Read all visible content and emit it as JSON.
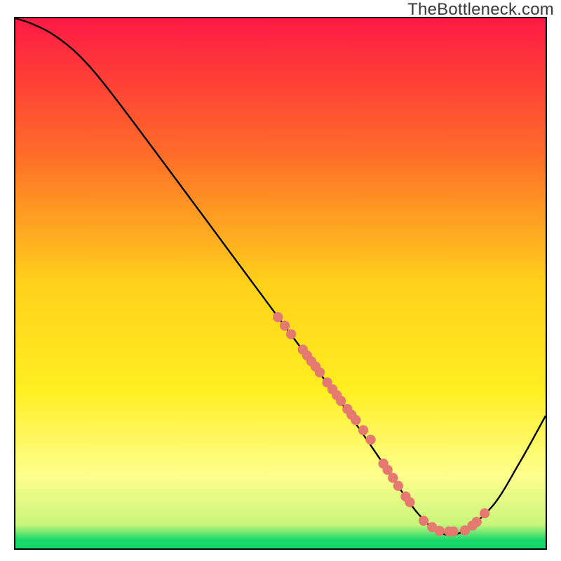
{
  "watermark": "TheBottleneck.com",
  "colors": {
    "red": "#ff1a44",
    "orange": "#ff8a1e",
    "yellow": "#ffe600",
    "paleYellow": "#ffff8c",
    "green": "#17d76a",
    "curve": "#000000",
    "dot": "#e47a6f",
    "frame": "#000000"
  },
  "chart_data": {
    "type": "line",
    "title": "",
    "xlabel": "",
    "ylabel": "",
    "xlim": [
      0,
      100
    ],
    "ylim": [
      0,
      100
    ],
    "curve": {
      "x": [
        0,
        3,
        7,
        12,
        18,
        30,
        40,
        50,
        60,
        68,
        72,
        76,
        80,
        84,
        90,
        95,
        100
      ],
      "y": [
        100,
        99,
        97,
        93,
        86,
        70,
        56.5,
        43,
        29.5,
        18,
        12,
        6.5,
        3,
        3,
        8,
        16,
        25
      ]
    },
    "dots": [
      {
        "x": 49.5,
        "y": 43.6
      },
      {
        "x": 50.8,
        "y": 42.0
      },
      {
        "x": 52.0,
        "y": 40.4
      },
      {
        "x": 54.2,
        "y": 37.5
      },
      {
        "x": 55.0,
        "y": 36.4
      },
      {
        "x": 55.8,
        "y": 35.3
      },
      {
        "x": 56.6,
        "y": 34.3
      },
      {
        "x": 57.4,
        "y": 33.2
      },
      {
        "x": 58.8,
        "y": 31.3
      },
      {
        "x": 59.8,
        "y": 30.0
      },
      {
        "x": 60.6,
        "y": 28.9
      },
      {
        "x": 61.4,
        "y": 27.8
      },
      {
        "x": 62.6,
        "y": 26.3
      },
      {
        "x": 63.4,
        "y": 25.2
      },
      {
        "x": 64.2,
        "y": 24.2
      },
      {
        "x": 65.6,
        "y": 22.3
      },
      {
        "x": 67.0,
        "y": 20.5
      },
      {
        "x": 69.4,
        "y": 16.0
      },
      {
        "x": 70.2,
        "y": 14.8
      },
      {
        "x": 71.2,
        "y": 13.3
      },
      {
        "x": 72.2,
        "y": 11.8
      },
      {
        "x": 73.6,
        "y": 9.8
      },
      {
        "x": 74.4,
        "y": 8.7
      },
      {
        "x": 77.0,
        "y": 5.2
      },
      {
        "x": 78.6,
        "y": 4.0
      },
      {
        "x": 80.0,
        "y": 3.3
      },
      {
        "x": 81.8,
        "y": 3.2
      },
      {
        "x": 82.6,
        "y": 3.2
      },
      {
        "x": 84.8,
        "y": 3.4
      },
      {
        "x": 86.2,
        "y": 4.3
      },
      {
        "x": 87.0,
        "y": 5.0
      },
      {
        "x": 88.5,
        "y": 6.6
      }
    ],
    "gradient_stops": [
      {
        "offset": 0.0,
        "color": "#ff1a44"
      },
      {
        "offset": 0.25,
        "color": "#ff6a2a"
      },
      {
        "offset": 0.5,
        "color": "#ffd11a"
      },
      {
        "offset": 0.7,
        "color": "#ffee20"
      },
      {
        "offset": 0.86,
        "color": "#ffff8c"
      },
      {
        "offset": 0.955,
        "color": "#c9f57a"
      },
      {
        "offset": 0.985,
        "color": "#17d76a"
      },
      {
        "offset": 1.0,
        "color": "#17d76a"
      }
    ]
  }
}
